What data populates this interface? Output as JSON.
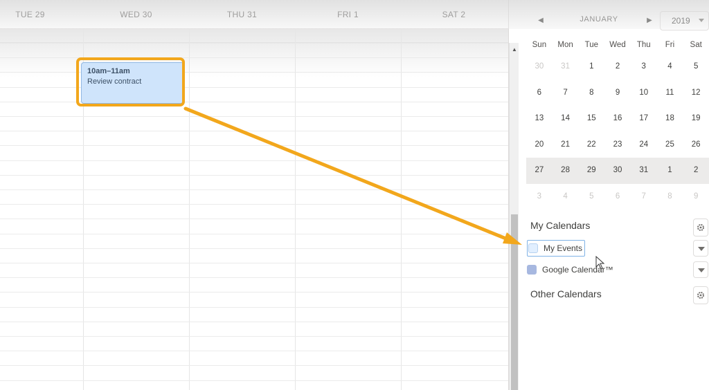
{
  "week": {
    "days": [
      "TUE 29",
      "WED 30",
      "THU 31",
      "FRI 1",
      "SAT 2"
    ]
  },
  "event": {
    "time": "10am–11am",
    "title": "Review contract",
    "color": "#cfe4fb",
    "highlight_color": "#f2a71c"
  },
  "mini_calendar": {
    "month": "JANUARY",
    "year": "2019",
    "weekdays": [
      "Sun",
      "Mon",
      "Tue",
      "Wed",
      "Thu",
      "Fri",
      "Sat"
    ],
    "weeks": [
      [
        "30",
        "31",
        "1",
        "2",
        "3",
        "4",
        "5"
      ],
      [
        "6",
        "7",
        "8",
        "9",
        "10",
        "11",
        "12"
      ],
      [
        "13",
        "14",
        "15",
        "16",
        "17",
        "18",
        "19"
      ],
      [
        "20",
        "21",
        "22",
        "23",
        "24",
        "25",
        "26"
      ],
      [
        "27",
        "28",
        "29",
        "30",
        "31",
        "1",
        "2"
      ],
      [
        "3",
        "4",
        "5",
        "6",
        "7",
        "8",
        "9"
      ]
    ]
  },
  "my_calendars": {
    "title": "My Calendars",
    "items": [
      {
        "label": "My Events",
        "color": "#cfe4fb"
      },
      {
        "label": "Google Calendar™",
        "color": "#a7b8e0"
      }
    ]
  },
  "other_calendars": {
    "title": "Other Calendars"
  },
  "icons": {
    "prev": "chevron-left-icon",
    "next": "chevron-right-icon",
    "settings": "gear-icon",
    "dropdown": "chevron-down-icon",
    "annotation": "arrow-icon"
  }
}
